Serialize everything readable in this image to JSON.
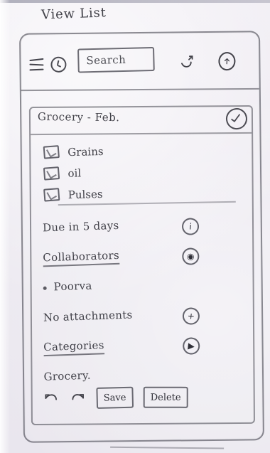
{
  "page": {
    "title": "View List"
  },
  "header": {
    "search": {
      "value": "",
      "placeholder": "Search"
    },
    "icons": {
      "menu": "menu-icon",
      "reminder": "clock-icon",
      "refresh": "refresh-icon",
      "profile": "upload-icon"
    }
  },
  "list": {
    "title": "Grocery - Feb.",
    "items": [
      {
        "label": "Grains",
        "checked": true
      },
      {
        "label": "oil",
        "checked": true
      },
      {
        "label": "Pulses",
        "checked": true
      }
    ],
    "details": [
      {
        "label": "Due in 5 days",
        "underlined": false,
        "icon": "info-icon"
      },
      {
        "label": "Collaborators",
        "underlined": true,
        "icon": "eye-icon"
      },
      {
        "label": "Poorva",
        "underlined": false,
        "icon": "",
        "bullet": true
      },
      {
        "label": "No attachments",
        "underlined": false,
        "icon": "add-icon"
      },
      {
        "label": "Categories",
        "underlined": true,
        "icon": "play-icon"
      },
      {
        "label": "Grocery.",
        "underlined": false,
        "icon": ""
      }
    ]
  },
  "actions": {
    "undo_icon": "undo-icon",
    "redo_icon": "redo-icon",
    "save_label": "Save",
    "delete_label": "Delete"
  }
}
